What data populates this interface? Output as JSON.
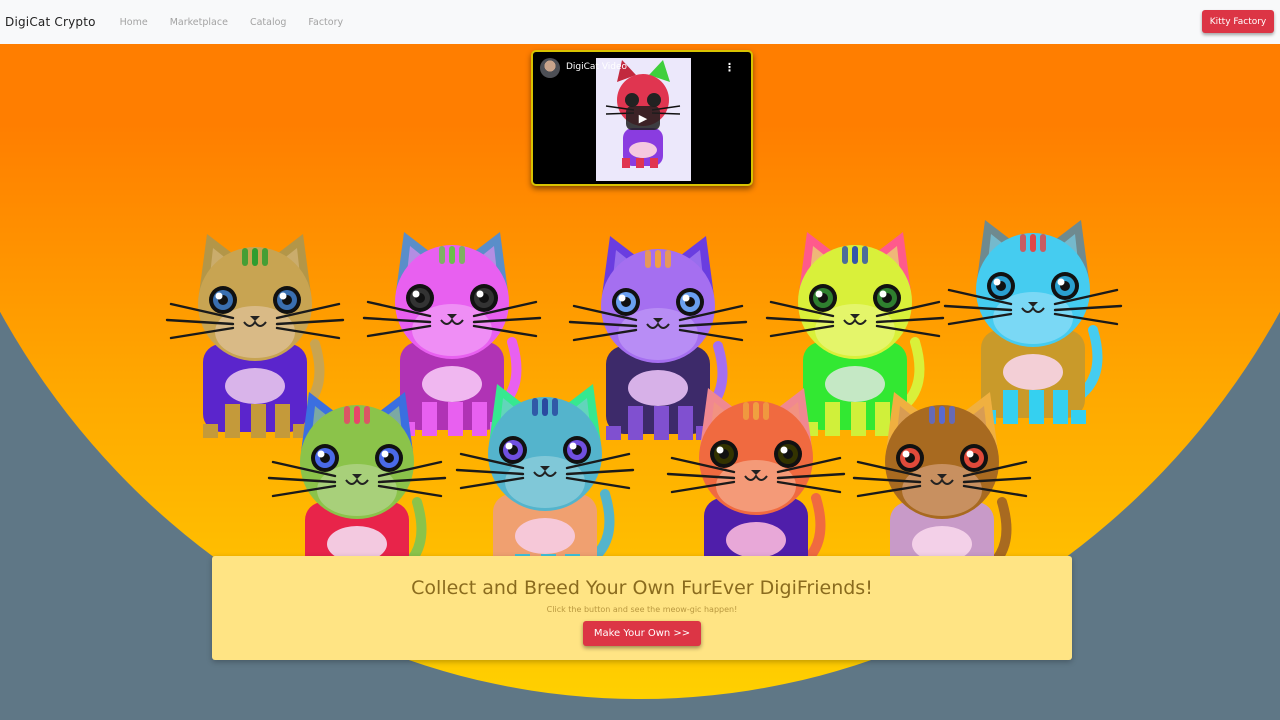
{
  "nav": {
    "brand": "DigiCat Crypto",
    "links": [
      "Home",
      "Marketplace",
      "Catalog",
      "Factory"
    ],
    "cta": "Kitty Factory"
  },
  "video": {
    "title": "DigiCat Video",
    "menu_icon": "more-vert-icon",
    "play_icon": "play-icon"
  },
  "hero": {
    "title": "Collect and Breed Your Own FurEver DigiFriends!",
    "subtitle": "Click the button and see the meow-gic happen!",
    "button": "Make Your Own >>"
  },
  "colors": {
    "primary": "#dc3545",
    "gradient_top": "#ff7700",
    "gradient_bottom": "#ffd000",
    "panel": "#ffe484",
    "background": "#5f7786"
  },
  "cats": [
    {
      "head": "#c8a452",
      "ears": "#b39648",
      "body": "#5b25cc",
      "belly": "#d9b4ea",
      "legs": "#c49a3a",
      "eye": "#3a6fb0",
      "muzzle": "#d9ba86",
      "tail": "#c8a452",
      "stripe": "#2f9d2f"
    },
    {
      "head": "#e860f0",
      "ears": "#5a8ec9",
      "body": "#b033b5",
      "belly": "#f0b7f0",
      "legs": "#e860f0",
      "eye": "#333333",
      "muzzle": "#ef8ef5",
      "tail": "#e860f0",
      "stripe": "#6bbf4a"
    },
    {
      "head": "#a56ff0",
      "ears": "#6a3de0",
      "body": "#3d2a6a",
      "belly": "#d7b1e8",
      "legs": "#8050d0",
      "eye": "#6aa0f0",
      "muzzle": "#b88df5",
      "tail": "#a56ff0",
      "stripe": "#f0a040"
    },
    {
      "head": "#d9f03a",
      "ears": "#ff5a8c",
      "body": "#32e832",
      "belly": "#c5e8c5",
      "legs": "#d0f03a",
      "eye": "#2f7f2f",
      "muzzle": "#e4f56a",
      "tail": "#d9f03a",
      "stripe": "#3355aa"
    },
    {
      "head": "#45ccf0",
      "ears": "#6f8a8f",
      "body": "#c99a2a",
      "belly": "#f3cfd6",
      "legs": "#35d0f0",
      "eye": "#2aa0d0",
      "muzzle": "#7ad8f5",
      "tail": "#45ccf0",
      "stripe": "#e04848"
    },
    {
      "head": "#8bc34a",
      "ears": "#3b6fe0",
      "body": "#e8244a",
      "belly": "#f3c9e0",
      "legs": "#7ec34a",
      "eye": "#4a6ae8",
      "muzzle": "#a8d07a",
      "tail": "#8bc34a",
      "stripe": "#e8446a"
    },
    {
      "head": "#54b4cc",
      "ears": "#36e890",
      "body": "#f0a070",
      "belly": "#f6c8d8",
      "legs": "#42c0d8",
      "eye": "#7050e0",
      "muzzle": "#80c8d8",
      "tail": "#54b4cc",
      "stripe": "#2a4aa0"
    },
    {
      "head": "#f06a40",
      "ears": "#f08890",
      "body": "#4f1eaa",
      "belly": "#e8a8d8",
      "legs": "#f06a40",
      "eye": "#333300",
      "muzzle": "#f49a78",
      "tail": "#f06a40",
      "stripe": "#f0a040"
    },
    {
      "head": "#a86a20",
      "ears": "#f0b040",
      "body": "#c89ac8",
      "belly": "#f3d0e8",
      "legs": "#a86a20",
      "eye": "#e04a3a",
      "muzzle": "#c89060",
      "tail": "#a86a20",
      "stripe": "#5a6ad0"
    }
  ]
}
